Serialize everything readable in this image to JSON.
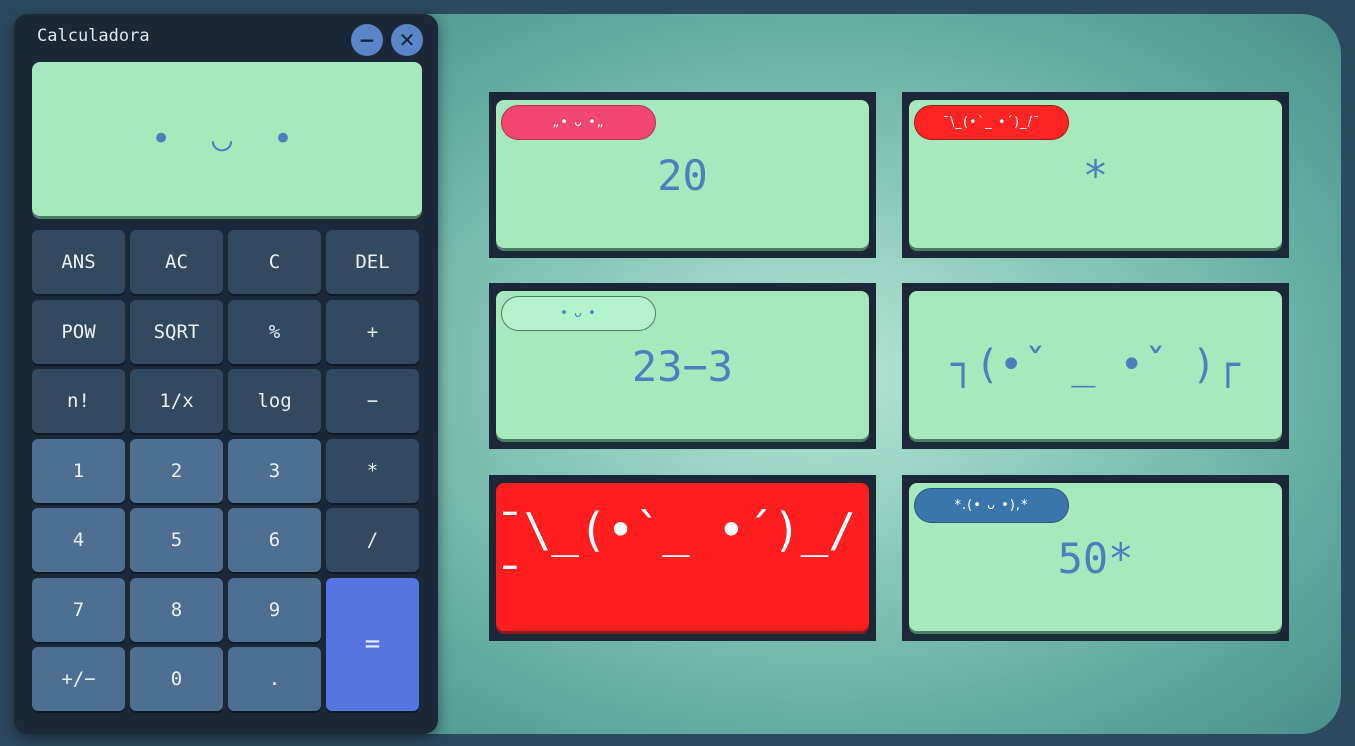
{
  "app": {
    "title": "Calculadora",
    "minimize_icon": "−",
    "close_icon": "✕"
  },
  "display": {
    "text": "• ◡ •"
  },
  "keys": [
    {
      "label": "ANS",
      "kind": "fn"
    },
    {
      "label": "AC",
      "kind": "fn"
    },
    {
      "label": "C",
      "kind": "fn"
    },
    {
      "label": "DEL",
      "kind": "fn"
    },
    {
      "label": "POW",
      "kind": "fn"
    },
    {
      "label": "SQRT",
      "kind": "fn"
    },
    {
      "label": "%",
      "kind": "fn"
    },
    {
      "label": "+",
      "kind": "fn"
    },
    {
      "label": "n!",
      "kind": "fn"
    },
    {
      "label": "1/x",
      "kind": "fn"
    },
    {
      "label": "log",
      "kind": "fn"
    },
    {
      "label": "−",
      "kind": "fn"
    },
    {
      "label": "1",
      "kind": "num"
    },
    {
      "label": "2",
      "kind": "num"
    },
    {
      "label": "3",
      "kind": "num"
    },
    {
      "label": "*",
      "kind": "fn"
    },
    {
      "label": "4",
      "kind": "num"
    },
    {
      "label": "5",
      "kind": "num"
    },
    {
      "label": "6",
      "kind": "num"
    },
    {
      "label": "/",
      "kind": "fn"
    },
    {
      "label": "7",
      "kind": "num"
    },
    {
      "label": "8",
      "kind": "num"
    },
    {
      "label": "9",
      "kind": "num"
    },
    {
      "label": "=",
      "kind": "eq"
    },
    {
      "label": "+/−",
      "kind": "num"
    },
    {
      "label": "0",
      "kind": "num"
    },
    {
      "label": ".",
      "kind": "num"
    }
  ],
  "tiles": [
    {
      "badge": "„• ᴗ •„",
      "badge_color": "#f1466f",
      "value": "20"
    },
    {
      "badge": "¯\\_(•`_ •´)_/¯",
      "badge_color": "#ff2424",
      "value": "*"
    },
    {
      "badge": "• ᴗ •",
      "badge_color": "#b2f3cd",
      "value": "23−3"
    },
    {
      "badge": "",
      "value": "┐(•ˇ _ •ˇ )┌"
    },
    {
      "badge": "",
      "value": "¯\\_(•`_ •´)_/¯",
      "card_color": "#ff1e1e"
    },
    {
      "badge": "*.(• ᴗ •),*",
      "badge_color": "#3a76aa",
      "value": "50*"
    }
  ],
  "colors": {
    "card_green": "#a5e9bd",
    "text_blue": "#4b80bd",
    "equals_blue": "#5675e0",
    "window_dark": "#1b2838"
  }
}
